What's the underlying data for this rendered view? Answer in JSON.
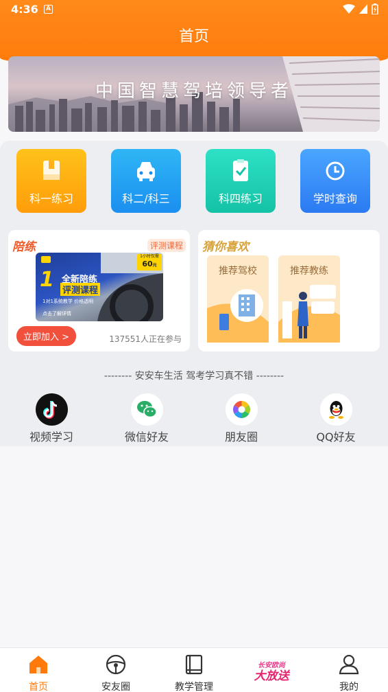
{
  "status_bar": {
    "time": "4:36",
    "notification_icon": "A"
  },
  "header": {
    "title": "首页"
  },
  "banner": {
    "text": "中国智慧驾培领导者"
  },
  "menu": [
    {
      "label": "科一练习",
      "icon": "book-icon",
      "color_from": "#ffc21a",
      "color_to": "#ff9d0a"
    },
    {
      "label": "科二/科三",
      "icon": "car-icon",
      "color_from": "#2fb6f5",
      "color_to": "#1b8ff0"
    },
    {
      "label": "科四练习",
      "icon": "clipboard-check-icon",
      "color_from": "#2ee0c5",
      "color_to": "#14c3a6"
    },
    {
      "label": "学时查询",
      "icon": "clock-icon",
      "color_from": "#4aa6ff",
      "color_to": "#2b7af2"
    }
  ],
  "peilian_card": {
    "title": "陪练",
    "tag": "评测课程",
    "ad_top": "1小时仅需",
    "ad_price": "60",
    "ad_price_unit": "元",
    "ad_headline_1": "全新陪练",
    "ad_headline_2": "评测课程",
    "ad_sub": "1对1系统教学 价格透明",
    "ad_footer": "点击了解详情",
    "join_label": "立即加入 >",
    "participants": "137551人正在参与"
  },
  "recommend_card": {
    "title": "猜你喜欢",
    "school_label": "推荐驾校",
    "coach_label": "推荐教练"
  },
  "slogan": "-------- 安安车生活  驾考学习真不错 --------",
  "share": [
    {
      "label": "视频学习",
      "icon": "tiktok-icon"
    },
    {
      "label": "微信好友",
      "icon": "wechat-icon"
    },
    {
      "label": "朋友圈",
      "icon": "moments-icon"
    },
    {
      "label": "QQ好友",
      "icon": "qq-icon"
    }
  ],
  "bottom_nav": [
    {
      "label": "首页",
      "icon": "home-icon",
      "active": true
    },
    {
      "label": "安友圈",
      "icon": "steering-wheel-icon",
      "active": false
    },
    {
      "label": "教学管理",
      "icon": "book-icon",
      "active": false
    },
    {
      "label": "长安欧尚大放送",
      "label_line1": "长安欧尚",
      "label_line2": "大放送",
      "icon": "promo-icon",
      "active": false
    },
    {
      "label": "我的",
      "icon": "user-icon",
      "active": false
    }
  ],
  "colors": {
    "brand_orange": "#ff7a0a",
    "accent_red": "#f0503c"
  }
}
